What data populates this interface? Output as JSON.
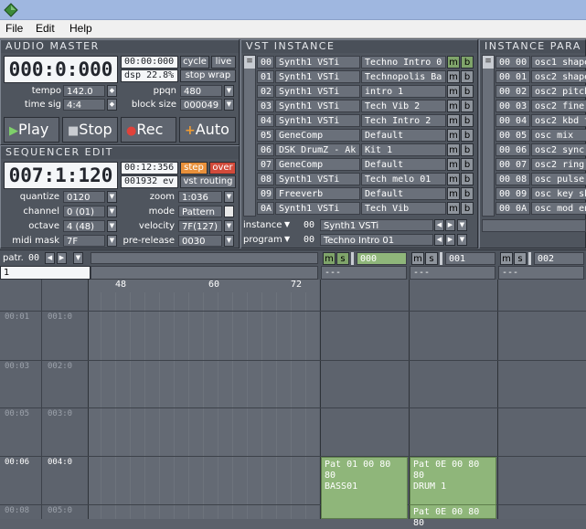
{
  "menu": [
    "File",
    "Edit",
    "Help"
  ],
  "audio_master": {
    "title": "AUDIO MASTER",
    "position": "000:0:000",
    "time": "00:00:000",
    "dsp": "dsp 22.8%",
    "cycle_label": "cycle",
    "live_label": "live",
    "stop_wrap_label": "stop wrap",
    "tempo_label": "tempo",
    "tempo_value": "142.0",
    "ppqn_label": "ppqn",
    "ppqn_value": "480",
    "timesig_label": "time sig",
    "timesig_value": "4:4",
    "blocksize_label": "block size",
    "blocksize_value": "000049",
    "play_label": "Play",
    "stop_label": "Stop",
    "rec_label": "Rec",
    "auto_label": "Auto"
  },
  "sequencer": {
    "title": "SEQUENCER EDIT",
    "position": "007:1:120",
    "time": "00:12:356",
    "events": "001932 ev",
    "step_label": "step",
    "over_label": "over",
    "vst_routing_label": "vst routing",
    "quantize_label": "quantize",
    "quantize_value": "0120",
    "zoom_label": "zoom",
    "zoom_value": "1:036",
    "channel_label": "channel",
    "channel_value": "0 (01)",
    "mode_label": "mode",
    "mode_value": "Pattern",
    "octave_label": "octave",
    "octave_value": "4 (48)",
    "velocity_label": "velocity",
    "velocity_value": "7F(127)",
    "midimask_label": "midi mask",
    "midimask_value": "7F",
    "prerelease_label": "pre-release",
    "prerelease_value": "0030"
  },
  "vst_instance": {
    "title": "VST INSTANCE",
    "rows": [
      {
        "id": "00",
        "plugin": "Synth1 VSTi",
        "preset": "Techno Intro 0",
        "m": true
      },
      {
        "id": "01",
        "plugin": "Synth1 VSTi",
        "preset": "Technopolis Ba",
        "m": false
      },
      {
        "id": "02",
        "plugin": "Synth1 VSTi",
        "preset": "intro 1",
        "m": false
      },
      {
        "id": "03",
        "plugin": "Synth1 VSTi",
        "preset": "Tech Vib 2",
        "m": false
      },
      {
        "id": "04",
        "plugin": "Synth1 VSTi",
        "preset": "Tech Intro 2",
        "m": false
      },
      {
        "id": "05",
        "plugin": "GeneComp",
        "preset": "Default",
        "m": false
      },
      {
        "id": "06",
        "plugin": "DSK DrumZ - Ak",
        "preset": "Kit 1",
        "m": false
      },
      {
        "id": "07",
        "plugin": "GeneComp",
        "preset": "Default",
        "m": false
      },
      {
        "id": "08",
        "plugin": "Synth1 VSTi",
        "preset": "Tech melo 01",
        "m": false
      },
      {
        "id": "09",
        "plugin": "Freeverb",
        "preset": "Default",
        "m": false
      },
      {
        "id": "0A",
        "plugin": "Synth1 VSTi",
        "preset": "Tech Vib",
        "m": false
      }
    ],
    "instance_label": "instance",
    "instance_id": "00",
    "instance_value": "Synth1 VSTi",
    "program_label": "program",
    "program_id": "00",
    "program_value": "Techno Intro 01"
  },
  "instance_params": {
    "title": "INSTANCE PARA",
    "rows": [
      {
        "id": "00 00",
        "name": "osc1 shape"
      },
      {
        "id": "00 01",
        "name": "osc2 shape"
      },
      {
        "id": "00 02",
        "name": "osc2 pitch"
      },
      {
        "id": "00 03",
        "name": "osc2 fine"
      },
      {
        "id": "00 04",
        "name": "osc2 kbd t"
      },
      {
        "id": "00 05",
        "name": "osc mix"
      },
      {
        "id": "00 06",
        "name": "osc2 sync"
      },
      {
        "id": "00 07",
        "name": "osc2 ring"
      },
      {
        "id": "00 08",
        "name": "osc pulse"
      },
      {
        "id": "00 09",
        "name": "osc key sh"
      },
      {
        "id": "00 0A",
        "name": "osc mod en"
      }
    ]
  },
  "pattern": {
    "patr_label": "patr.",
    "patr_value": "00",
    "row_value": "1",
    "ruler": [
      "48",
      "60",
      "72"
    ],
    "tracks": [
      {
        "label": "000",
        "sub": "---"
      },
      {
        "label": "001",
        "sub": "---"
      },
      {
        "label": "002",
        "sub": "---"
      }
    ],
    "rows": [
      {
        "time": "00:01",
        "pos": "001:0"
      },
      {
        "time": "00:03",
        "pos": "002:0"
      },
      {
        "time": "00:05",
        "pos": "003:0"
      },
      {
        "time": "00:06",
        "pos": "004:0"
      },
      {
        "time": "00:08",
        "pos": "005:0"
      }
    ],
    "blocks": [
      {
        "l1": "Pat 01 00 80 80",
        "l2": "BASS01"
      },
      {
        "l1": "Pat 0E 00 80 80",
        "l2": "DRUM 1"
      },
      {
        "l1": "Pat 0E 00 80 80",
        "l2": ""
      }
    ]
  }
}
